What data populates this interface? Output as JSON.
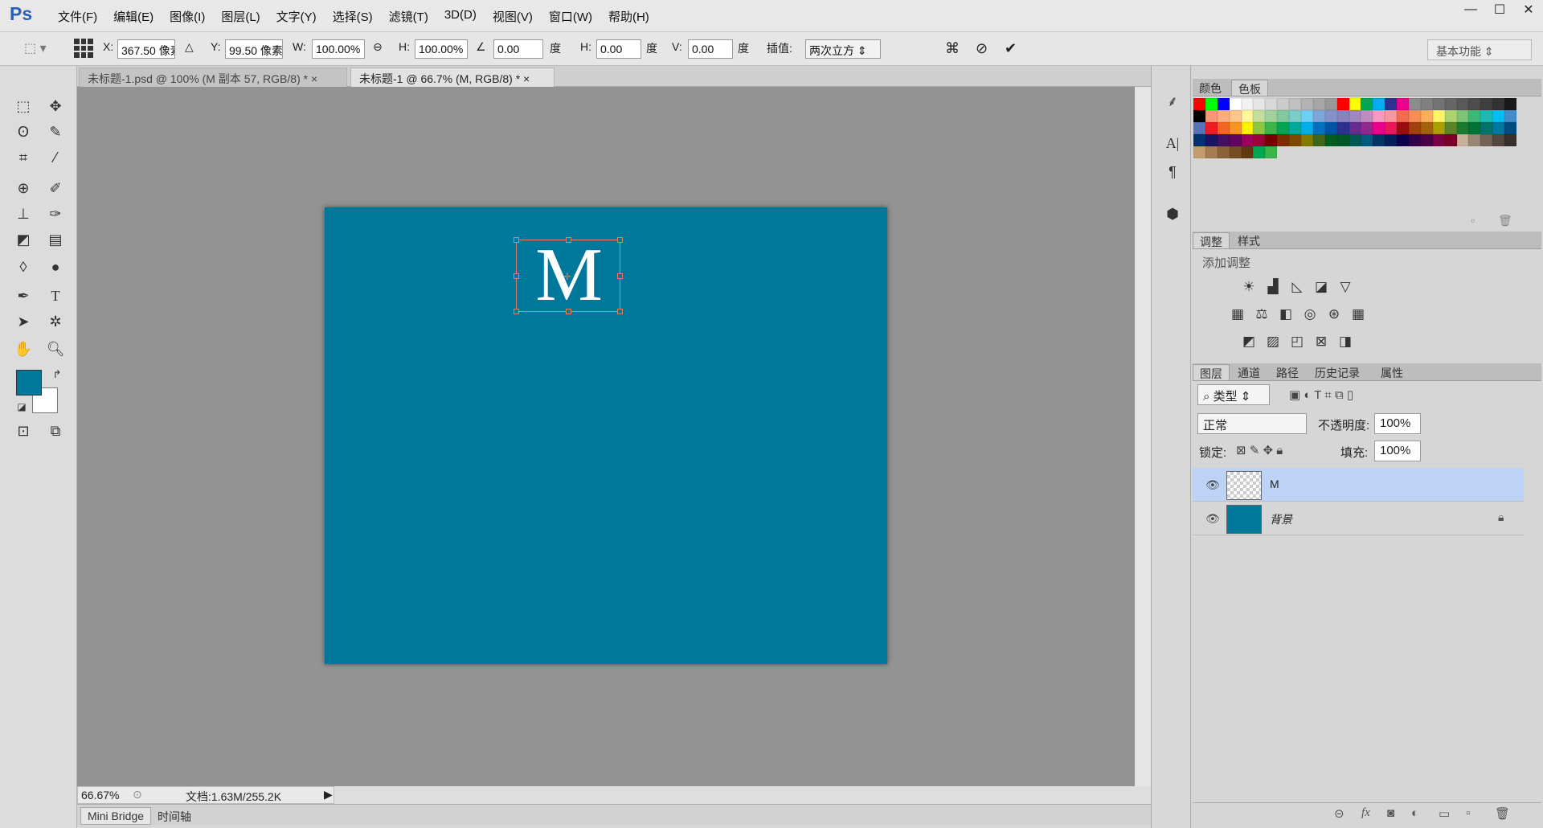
{
  "app": {
    "logo": "Ps"
  },
  "menubar": {
    "items": [
      "文件(F)",
      "编辑(E)",
      "图像(I)",
      "图层(L)",
      "文字(Y)",
      "选择(S)",
      "滤镜(T)",
      "3D(D)",
      "视图(V)",
      "窗口(W)",
      "帮助(H)"
    ]
  },
  "window": {
    "minimize": "—",
    "maximize": "☐",
    "close": "✕"
  },
  "options": {
    "x_label": "X:",
    "x_value": "367.50 像素",
    "y_label": "Y:",
    "y_value": "99.50 像素",
    "w_label": "W:",
    "w_value": "100.00%",
    "h_label": "H:",
    "h_value": "100.00%",
    "angle_value": "0.00",
    "angle_unit": "度",
    "skew_h_label": "H:",
    "skew_h_value": "0.00",
    "skew_h_unit": "度",
    "skew_v_label": "V:",
    "skew_v_value": "0.00",
    "skew_v_unit": "度",
    "interp_label": "插值:",
    "interp_value": "两次立方",
    "workspace": "基本功能"
  },
  "tabs": [
    {
      "label": "未标题-1.psd @ 100% (M 副本 57, RGB/8) *",
      "close": "×"
    },
    {
      "label": "未标题-1 @ 66.7% (M, RGB/8) *",
      "close": "×"
    }
  ],
  "canvas": {
    "letter": "M",
    "bg_color": "#00789b"
  },
  "status": {
    "zoom": "66.67%",
    "doc": "文档:1.63M/255.2K"
  },
  "bottom_tabs": [
    "Mini Bridge",
    "时间轴"
  ],
  "colors": {
    "foreground": "#00789b",
    "background": "#ffffff",
    "selection": "#bcd3f5"
  },
  "panels": {
    "color_tabs": [
      "颜色",
      "色板"
    ],
    "adjust_tabs": [
      "调整",
      "样式"
    ],
    "adjust_title": "添加调整",
    "layer_tabs": [
      "图层",
      "通道",
      "路径",
      "历史记录",
      "属性"
    ],
    "filter_kind": "类型",
    "blend_mode": "正常",
    "opacity_label": "不透明度:",
    "opacity_value": "100%",
    "lock_label": "锁定:",
    "fill_label": "填充:",
    "fill_value": "100%",
    "layers": [
      {
        "name": "M",
        "selected": true
      },
      {
        "name": "背景",
        "selected": false,
        "locked": true
      }
    ]
  },
  "swatch_colors": [
    "#ff0000",
    "#00ff00",
    "#0000ff",
    "#ffffff",
    "#f2f2f2",
    "#e6e6e6",
    "#d9d9d9",
    "#cccccc",
    "#c0c0c0",
    "#b3b3b3",
    "#a6a6a6",
    "#999999",
    "#ff0000",
    "#ffff00",
    "#00a651",
    "#00aeef",
    "#2e3192",
    "#ec008c",
    "#8c8c8c",
    "#808080",
    "#737373",
    "#666666",
    "#595959",
    "#4d4d4d",
    "#404040",
    "#333333",
    "#1a1a1a",
    "#000000",
    "#f7977a",
    "#f9ad81",
    "#fdc68a",
    "#fff79a",
    "#c4df9b",
    "#a3d39c",
    "#82ca9d",
    "#7bcdc8",
    "#6ecff6",
    "#7ea7d8",
    "#8493ca",
    "#8882be",
    "#a187be",
    "#bc8dbf",
    "#f49ac2",
    "#f6989d",
    "#f26c4f",
    "#f68e55",
    "#fbaf5c",
    "#fff467",
    "#acd372",
    "#7cc576",
    "#3bb878",
    "#1abbb4",
    "#00bff3",
    "#438ccb",
    "#5574b9",
    "#ed1c24",
    "#f26522",
    "#f7941d",
    "#fff200",
    "#8dc73f",
    "#39b54a",
    "#00a651",
    "#00a99d",
    "#00aeef",
    "#0072bc",
    "#0054a6",
    "#2e3192",
    "#662d91",
    "#92278f",
    "#ec008c",
    "#ed145b",
    "#9e0b0f",
    "#a0410d",
    "#a3620a",
    "#aba000",
    "#598527",
    "#1a7b30",
    "#007236",
    "#00746b",
    "#0076a3",
    "#004b80",
    "#003471",
    "#1b1464",
    "#440e62",
    "#630460",
    "#9e005d",
    "#9e0039",
    "#790000",
    "#7b2e00",
    "#7d4900",
    "#827b00",
    "#406618",
    "#005e20",
    "#005826",
    "#005952",
    "#005b7f",
    "#003663",
    "#002157",
    "#0d004c",
    "#32004b",
    "#4b0049",
    "#7b0046",
    "#7a0026",
    "#c7b299",
    "#998675",
    "#736357",
    "#534741",
    "#37302d",
    "#c69c6d",
    "#a67c52",
    "#8c6239",
    "#754c24",
    "#603913",
    "#00a651",
    "#39b54a"
  ]
}
